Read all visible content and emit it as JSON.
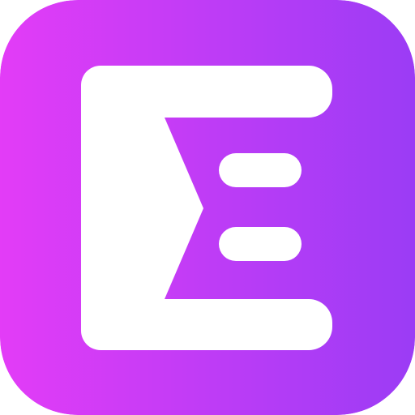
{
  "icon": {
    "name": "E-logo-app-icon",
    "glyph": "letter-e-logo-icon",
    "colors": {
      "gradient_start": "#e33cf7",
      "gradient_end": "#9b3cf5",
      "mark": "#ffffff"
    }
  }
}
